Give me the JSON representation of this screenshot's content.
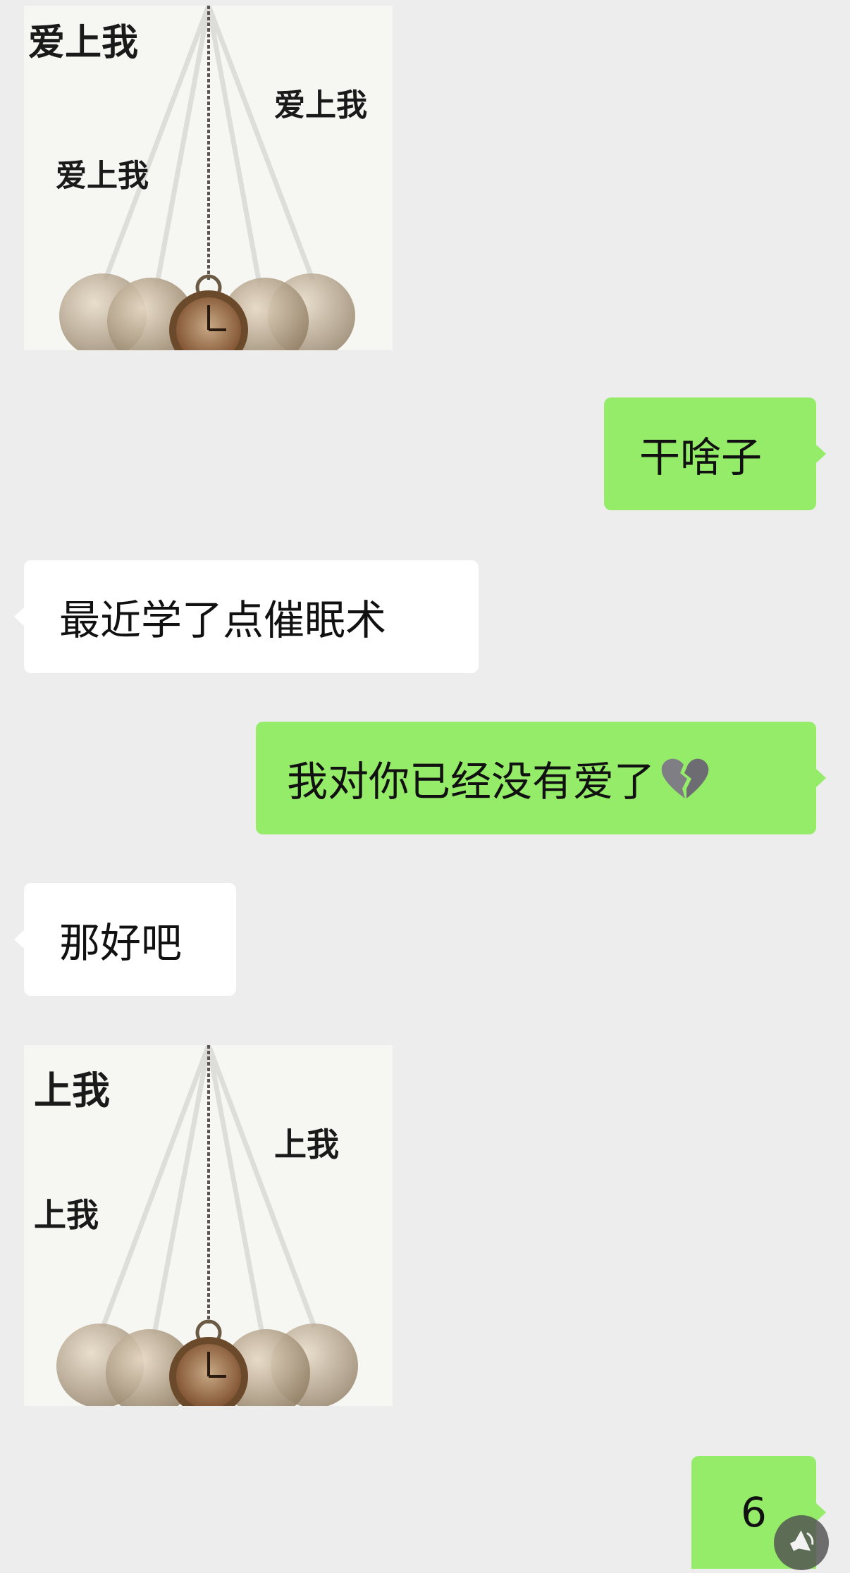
{
  "messages": [
    {
      "id": "img1",
      "type": "image",
      "side": "left",
      "captions": [
        "爱上我",
        "爱上我",
        "爱上我"
      ]
    },
    {
      "id": "m1",
      "type": "text",
      "side": "right",
      "text": "干啥子"
    },
    {
      "id": "m2",
      "type": "text",
      "side": "left",
      "text": "最近学了点催眠术"
    },
    {
      "id": "m3",
      "type": "text",
      "side": "right",
      "text": "我对你已经没有爱了",
      "emoji": "broken-heart-icon"
    },
    {
      "id": "m4",
      "type": "text",
      "side": "left",
      "text": "那好吧"
    },
    {
      "id": "img2",
      "type": "image",
      "side": "left",
      "captions": [
        "上我",
        "上我",
        "上我"
      ]
    },
    {
      "id": "m5",
      "type": "text",
      "side": "right",
      "text": "6"
    }
  ],
  "colors": {
    "background": "#ededed",
    "sent_bubble": "#95ec69",
    "received_bubble": "#ffffff"
  },
  "floating_button": {
    "icon": "speaker-icon"
  }
}
